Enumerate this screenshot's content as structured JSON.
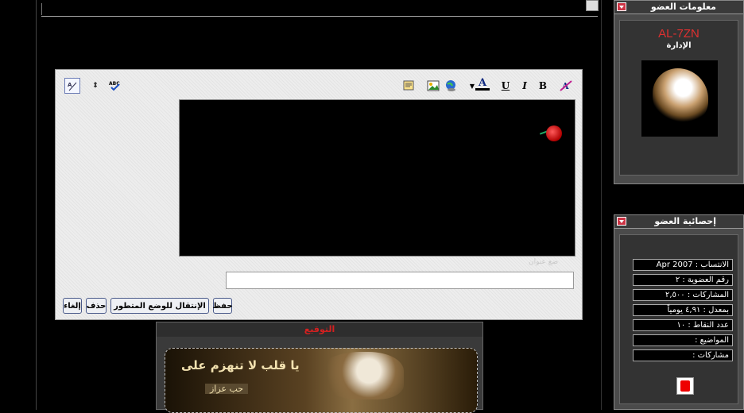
{
  "editor": {
    "hint_text": "ضع عنوان",
    "title_value": "",
    "buttons": {
      "save": "حفظ",
      "advanced": "الإنتقال للوضع المتطور",
      "delete": "حذف",
      "cancel": "إلغاء"
    },
    "toolbar": {
      "bold": "B",
      "italic": "I",
      "underline": "U",
      "font_color": "A"
    }
  },
  "signature": {
    "heading": "التوقيع",
    "line1": "يا قلب لا تنهزم على",
    "line2": "حب عزاز"
  },
  "member_info": {
    "heading": "معلومات العضو",
    "username": "AL-7ZN",
    "role": "الإدارة"
  },
  "member_stats": {
    "heading": "إحصائية العضو",
    "rows": [
      "الانتساب : Apr 2007",
      "رقم العضوية : ٢",
      "المشاركات : ٢,٥٠٠",
      "بمعدل : ٤,٩١ يومياً",
      "عدد النقاط : ١٠",
      "المواضيع :",
      "مشاركات :"
    ]
  },
  "colors": {
    "username": "#e03030",
    "signature_heading": "#d42020",
    "panel_bg": "#4b4b4b"
  }
}
